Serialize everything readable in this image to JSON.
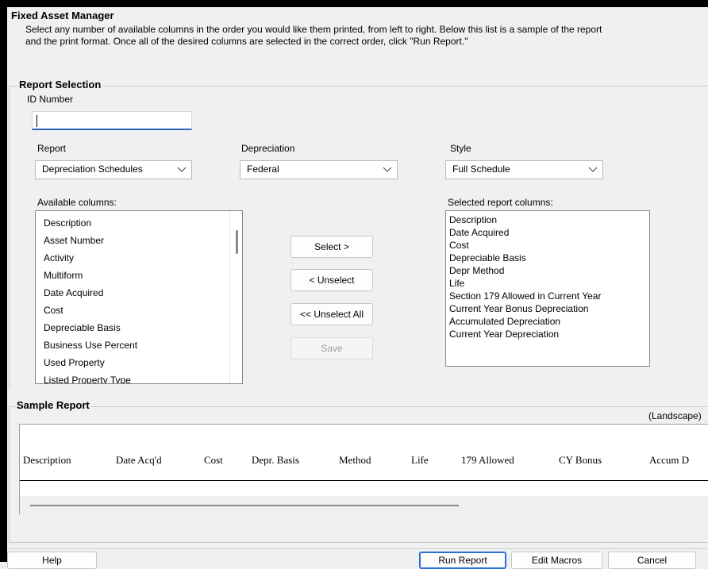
{
  "title": "Fixed Asset Manager",
  "instructions": [
    "Select any number of available columns in the order you would like them printed, from left to right. Below this list is a sample of the report",
    "and the print format. Once all of the desired columns are selected in the correct order, click \"Run Report.\""
  ],
  "report_selection": {
    "group_label": "Report Selection",
    "id_label": "ID Number",
    "id_value": "",
    "report_label": "Report",
    "report_value": "Depreciation Schedules",
    "depreciation_label": "Depreciation",
    "depreciation_value": "Federal",
    "style_label": "Style",
    "style_value": "Full Schedule",
    "available_label": "Available columns:",
    "available_items": [
      "Description",
      "Asset Number",
      "Activity",
      "Multiform",
      "Date Acquired",
      "Cost",
      "Depreciable Basis",
      "Business Use Percent",
      "Used Property",
      "Listed Property Type"
    ],
    "selected_label": "Selected report columns:",
    "selected_items": [
      "Description",
      "Date Acquired",
      "Cost",
      "Depreciable Basis",
      "Depr Method",
      "Life",
      "Section 179 Allowed in Current Year",
      "Current Year Bonus Depreciation",
      "Accumulated Depreciation",
      "Current Year Depreciation"
    ],
    "buttons": {
      "select": "Select >",
      "unselect": "< Unselect",
      "unselect_all": "<< Unselect All",
      "save": "Save"
    }
  },
  "sample_report": {
    "group_label": "Sample Report",
    "orientation": "(Landscape)",
    "headers": [
      "Description",
      "Date Acq'd",
      "Cost",
      "Depr. Basis",
      "Method",
      "Life",
      "179 Allowed",
      "CY Bonus",
      "Accum D"
    ]
  },
  "footer": {
    "help": "Help",
    "run_report": "Run Report",
    "edit_macros": "Edit Macros",
    "cancel": "Cancel"
  },
  "colors": {
    "accent": "#2b6fd1",
    "dialog_bg": "#f0f0f0",
    "frame": "#000000"
  }
}
